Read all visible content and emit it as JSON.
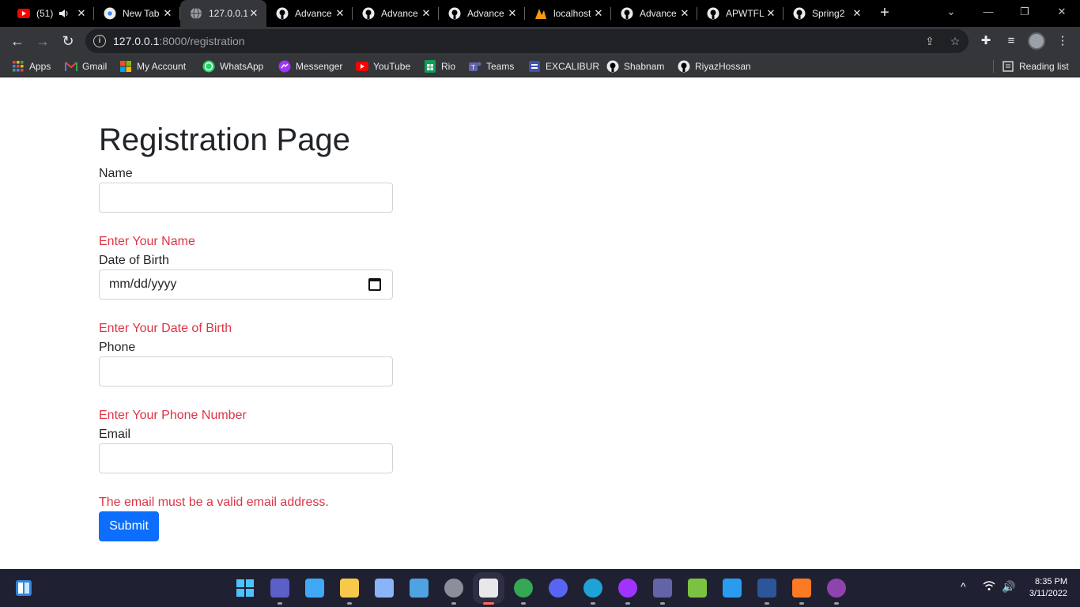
{
  "browser": {
    "tabs": [
      {
        "title": "(51)",
        "icon": "youtube-icon",
        "color": "#ff0000",
        "active": false,
        "extra": "speaker-icon"
      },
      {
        "title": "New Tab",
        "icon": "chrome-icon",
        "color": "#e8eaed",
        "active": false
      },
      {
        "title": "127.0.0.1",
        "icon": "globe-icon",
        "color": "#9aa0a6",
        "active": true
      },
      {
        "title": "Advance",
        "icon": "github-icon",
        "color": "#e8eaed",
        "active": false
      },
      {
        "title": "Advance",
        "icon": "github-icon",
        "color": "#e8eaed",
        "active": false
      },
      {
        "title": "Advance",
        "icon": "github-icon",
        "color": "#e8eaed",
        "active": false
      },
      {
        "title": "localhost",
        "icon": "phpmyadmin-icon",
        "color": "#f89c0e",
        "active": false
      },
      {
        "title": "Advance",
        "icon": "github-icon",
        "color": "#e8eaed",
        "active": false
      },
      {
        "title": "APWTFL",
        "icon": "github-icon",
        "color": "#e8eaed",
        "active": false
      },
      {
        "title": "Spring2",
        "icon": "github-icon",
        "color": "#e8eaed",
        "active": false
      }
    ],
    "url_host": "127.0.0.1",
    "url_path": ":8000/registration",
    "bookmarks": [
      {
        "label": "Apps",
        "icon": "apps-grid-icon",
        "color": "#ea4335"
      },
      {
        "label": "Gmail",
        "icon": "gmail-icon",
        "color": "#ea4335"
      },
      {
        "label": "My Account",
        "icon": "microsoft-icon",
        "color": "#f25022"
      },
      {
        "label": "WhatsApp",
        "icon": "whatsapp-icon",
        "color": "#25d366"
      },
      {
        "label": "Messenger",
        "icon": "messenger-icon",
        "color": "#a033ff"
      },
      {
        "label": "YouTube",
        "icon": "youtube-icon",
        "color": "#ff0000"
      },
      {
        "label": "Rio",
        "icon": "sheets-icon",
        "color": "#0f9d58"
      },
      {
        "label": "Teams",
        "icon": "teams-icon",
        "color": "#6264a7"
      },
      {
        "label": "EXCALIBUR",
        "icon": "excalibur-icon",
        "color": "#3f51b5"
      },
      {
        "label": "Shabnam",
        "icon": "github-icon",
        "color": "#e8eaed"
      },
      {
        "label": "RiyazHossan",
        "icon": "github-icon",
        "color": "#e8eaed"
      }
    ],
    "reading_list": "Reading list"
  },
  "page": {
    "title": "Registration Page",
    "fields": [
      {
        "label": "Name",
        "value": "",
        "placeholder": "",
        "type": "text",
        "error": "Enter Your Name"
      },
      {
        "label": "Date of Birth",
        "value": "mm/dd/yyyy",
        "placeholder": "",
        "type": "date",
        "error": "Enter Your Date of Birth"
      },
      {
        "label": "Phone",
        "value": "",
        "placeholder": "",
        "type": "text",
        "error": "Enter Your Phone Number"
      },
      {
        "label": "Email",
        "value": "",
        "placeholder": "",
        "type": "text",
        "error": "The email must be a valid email address."
      }
    ],
    "submit_label": "Submit",
    "error_color": "#dc3545",
    "button_color": "#0d6efd"
  },
  "taskbar": {
    "apps": [
      {
        "name": "zoom-icon",
        "color": "#5b5fc7"
      },
      {
        "name": "remote-desktop-icon",
        "color": "#3fa9f5"
      },
      {
        "name": "file-explorer-icon",
        "color": "#f7c84b"
      },
      {
        "name": "task-monitor-icon",
        "color": "#8ab4f8"
      },
      {
        "name": "image-viewer-icon",
        "color": "#4fa3e0"
      },
      {
        "name": "settings-icon",
        "color": "#8a8f99"
      },
      {
        "name": "snipping-tool-icon",
        "color": "#e8e8e8"
      },
      {
        "name": "chrome-icon",
        "color": "#34a853"
      },
      {
        "name": "discord-icon",
        "color": "#5865f2"
      },
      {
        "name": "edge-icon",
        "color": "#1fa3d6"
      },
      {
        "name": "messenger-icon",
        "color": "#a033ff"
      },
      {
        "name": "teams-icon",
        "color": "#6264a7"
      },
      {
        "name": "bluestacks-icon",
        "color": "#7cc242"
      },
      {
        "name": "vscode-icon",
        "color": "#2a9cf0"
      },
      {
        "name": "word-icon",
        "color": "#2b579a"
      },
      {
        "name": "xampp-icon",
        "color": "#fb7a24"
      },
      {
        "name": "github-desktop-icon",
        "color": "#8e44ad"
      }
    ],
    "time": "8:35 PM",
    "date": "3/11/2022"
  }
}
